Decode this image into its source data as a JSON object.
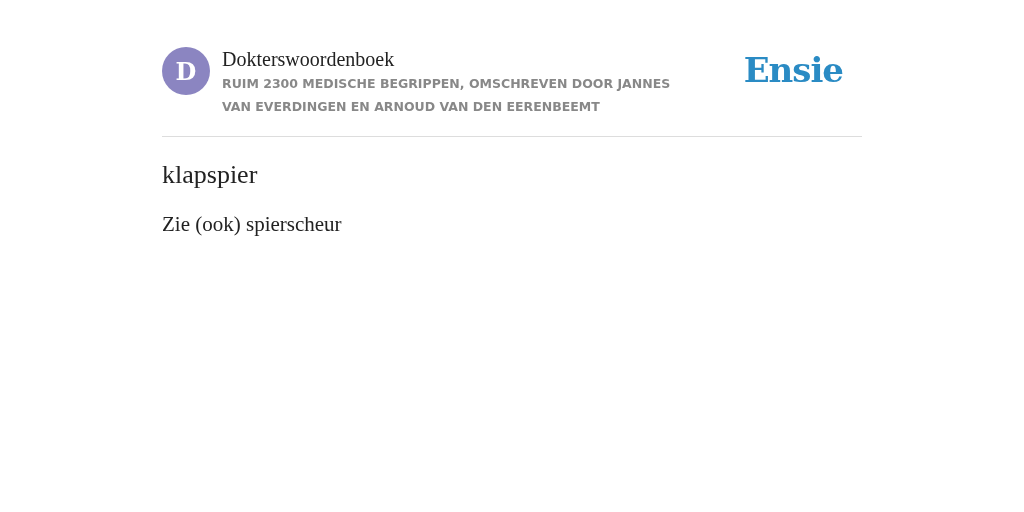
{
  "dictionary": {
    "avatar_letter": "D",
    "title": "Dokterswoordenboek",
    "subtitle": "RUIM 2300 MEDISCHE BEGRIPPEN, OMSCHREVEN DOOR JANNES VAN EVERDINGEN EN ARNOUD VAN DEN EERENBEEMT"
  },
  "logo": "Ensie",
  "entry": {
    "term": "klapspier",
    "definition": "Zie (ook) spierscheur"
  }
}
